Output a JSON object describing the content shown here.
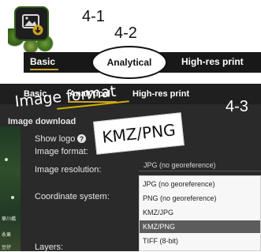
{
  "callouts": {
    "step_1": "4-1",
    "step_2": "4-2",
    "step_3": "4-3",
    "handwritten_image_format": "Image format",
    "handwritten_kmz_png": "KMZ/PNG"
  },
  "top_tabs": {
    "basic": "Basic",
    "analytical": "Analytical",
    "high_res_print": "High-res print"
  },
  "panel": {
    "tabs": {
      "basic": "Basic",
      "analytical": "Analytical",
      "high_res_print": "High-res print"
    },
    "section_title": "Image download",
    "labels": {
      "show_logo": "Show logo",
      "image_format": "Image format:",
      "image_resolution": "Image resolution:",
      "coordinate_system": "Coordinate system:",
      "layers": "Layers:"
    },
    "help_icon_text": "?",
    "format_select_value": "JPG (no georeference)",
    "format_options": [
      "JPG (no georeference)",
      "PNG (no georeference)",
      "KMZ/JPG",
      "KMZ/PNG",
      "TIFF (8-bit)"
    ],
    "selected_format_index": 3,
    "map_labels": [
      "華川橋",
      "永東",
      "豆仔"
    ]
  },
  "colors": {
    "accent_underline": "#c9a126",
    "panel_bg": "#2a2a2a",
    "tab_bar_bg": "#181818"
  },
  "icons": {
    "map_download": "map-download-icon",
    "help": "help-circle-icon"
  }
}
